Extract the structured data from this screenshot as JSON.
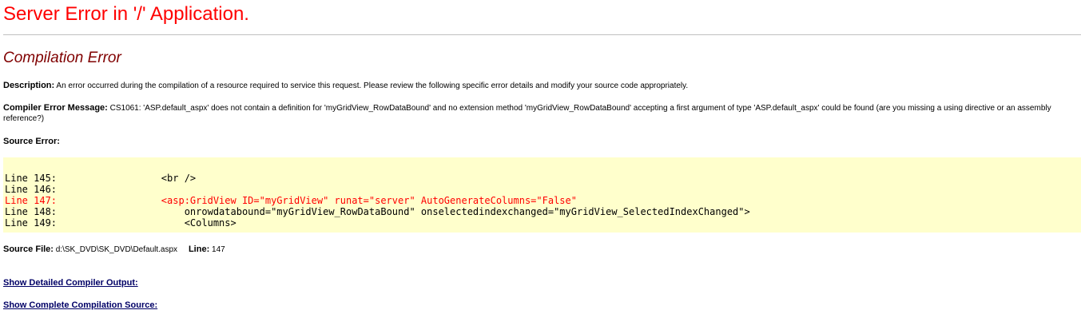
{
  "header": {
    "title": "Server Error in '/' Application.",
    "subtitle": "Compilation Error"
  },
  "description": {
    "label": "Description:",
    "text": "An error occurred during the compilation of a resource required to service this request. Please review the following specific error details and modify your source code appropriately."
  },
  "compiler_error": {
    "label": "Compiler Error Message:",
    "text": "CS1061: 'ASP.default_aspx' does not contain a definition for 'myGridView_RowDataBound' and no extension method 'myGridView_RowDataBound' accepting a first argument of type 'ASP.default_aspx' could be found (are you missing a using directive or an assembly reference?)"
  },
  "source_error": {
    "label": "Source Error:",
    "lines": [
      {
        "number": "Line 145:",
        "code": "<br />",
        "indent": "        ",
        "is_error": false
      },
      {
        "number": "Line 146:",
        "code": "",
        "indent": "",
        "is_error": false
      },
      {
        "number": "Line 147:",
        "code": "<asp:GridView ID=\"myGridView\" runat=\"server\" AutoGenerateColumns=\"False\"",
        "indent": "        ",
        "is_error": true
      },
      {
        "number": "Line 148:",
        "code": "onrowdatabound=\"myGridView_RowDataBound\" onselectedindexchanged=\"myGridView_SelectedIndexChanged\">",
        "indent": "            ",
        "is_error": false
      },
      {
        "number": "Line 149:",
        "code": "<Columns>",
        "indent": "            ",
        "is_error": false
      }
    ]
  },
  "source_file": {
    "label": "Source File:",
    "path": "d:\\SK_DVD\\SK_DVD\\Default.aspx",
    "line_label": "Line:",
    "line_value": "147"
  },
  "links": {
    "compiler_output": "Show Detailed Compiler Output:",
    "compilation_source": "Show Complete Compilation Source:"
  },
  "colors": {
    "title": "#ff0000",
    "subtitle": "#800000",
    "code_background": "#ffffcc",
    "error_line": "#ff0000",
    "link": "#000066"
  }
}
